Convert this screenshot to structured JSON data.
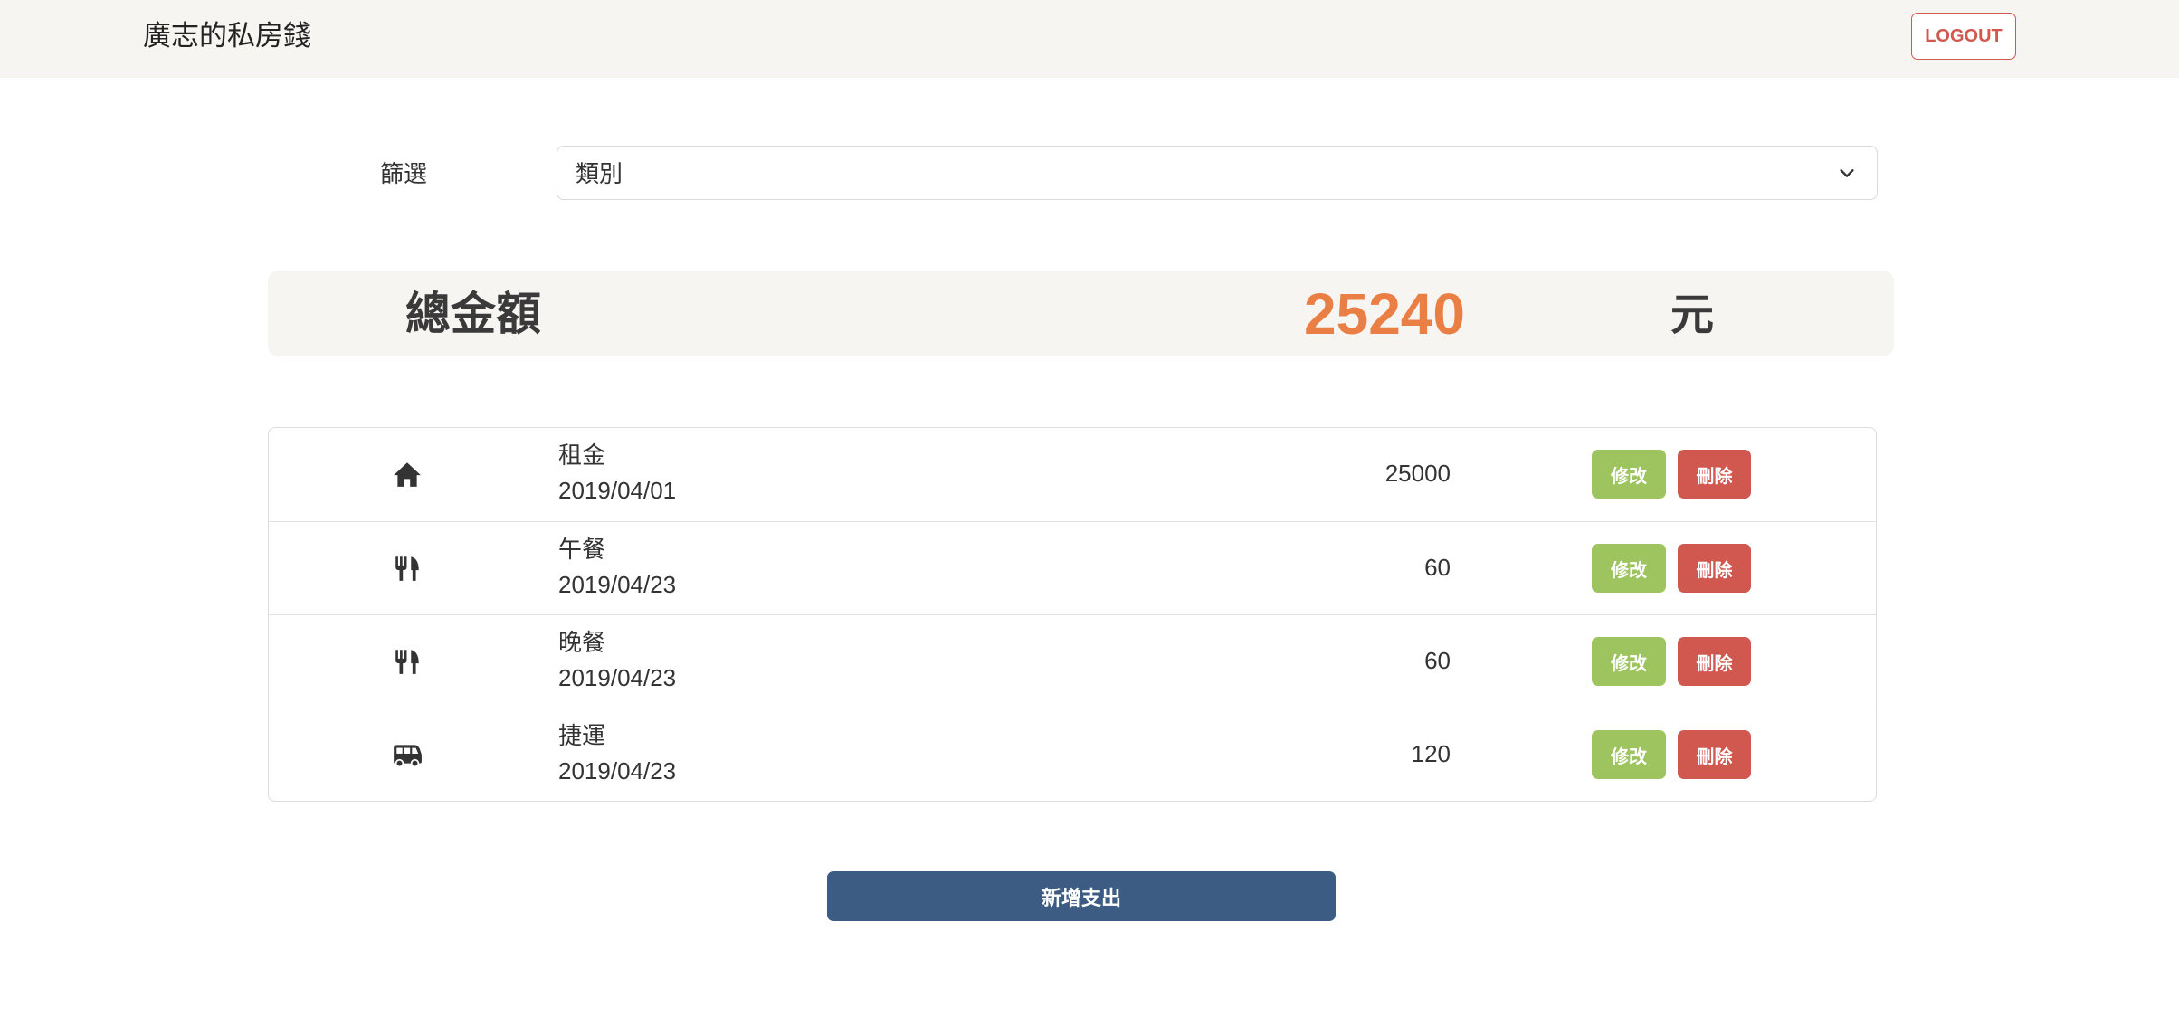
{
  "header": {
    "title": "廣志的私房錢",
    "logout_label": "LOGOUT"
  },
  "filter": {
    "label": "篩選",
    "selected": "類別"
  },
  "summary": {
    "label": "總金額",
    "amount": "25240",
    "unit": "元"
  },
  "expenses": [
    {
      "icon": "home-icon",
      "title": "租金",
      "date": "2019/04/01",
      "amount": "25000",
      "edit_label": "修改",
      "delete_label": "刪除"
    },
    {
      "icon": "utensils-icon",
      "title": "午餐",
      "date": "2019/04/23",
      "amount": "60",
      "edit_label": "修改",
      "delete_label": "刪除"
    },
    {
      "icon": "utensils-icon",
      "title": "晚餐",
      "date": "2019/04/23",
      "amount": "60",
      "edit_label": "修改",
      "delete_label": "刪除"
    },
    {
      "icon": "bus-icon",
      "title": "捷運",
      "date": "2019/04/23",
      "amount": "120",
      "edit_label": "修改",
      "delete_label": "刪除"
    }
  ],
  "add_button": {
    "label": "新增支出"
  },
  "colors": {
    "accent_orange": "#ea7f45",
    "edit_green": "#9dc45e",
    "delete_red": "#d0584f",
    "primary_blue": "#3d5c83",
    "header_bg": "#f7f5f1"
  }
}
